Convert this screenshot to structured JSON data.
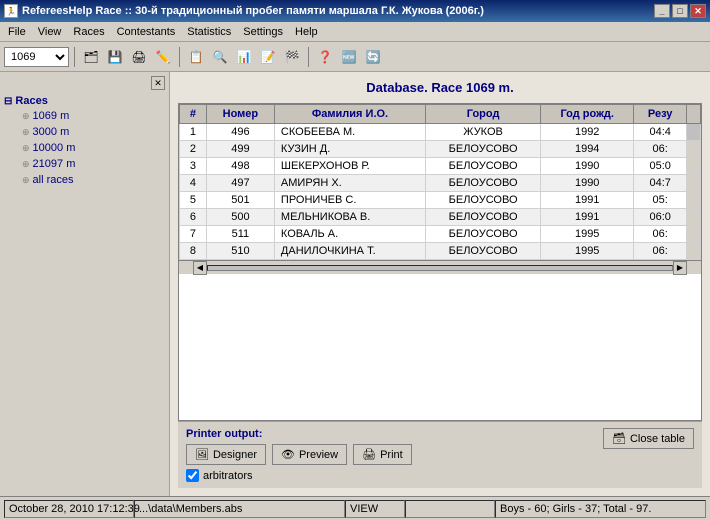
{
  "titlebar": {
    "text": "RefereesHelp Race :: 30-й традиционный пробег памяти маршала Г.К. Жукова (2006г.)",
    "buttons": [
      "_",
      "□",
      "✕"
    ]
  },
  "menubar": {
    "items": [
      "File",
      "View",
      "Races",
      "Contestants",
      "Statistics",
      "Settings",
      "Help"
    ]
  },
  "toolbar": {
    "select_value": "1069"
  },
  "sidebar": {
    "title": "Races",
    "items": [
      {
        "label": "1069 m"
      },
      {
        "label": "3000 m"
      },
      {
        "label": "10000 m"
      },
      {
        "label": "21097 m"
      },
      {
        "label": "all races"
      }
    ]
  },
  "content": {
    "title": "Database. Race 1069 m.",
    "table": {
      "columns": [
        "#",
        "Номер",
        "Фамилия И.О.",
        "Город",
        "Год рожд.",
        "Резу"
      ],
      "rows": [
        [
          "1",
          "496",
          "СКОБЕЕВА М.",
          "ЖУКОВ",
          "1992",
          "04:4"
        ],
        [
          "2",
          "499",
          "КУЗИН Д.",
          "БЕЛОУСОВО",
          "1994",
          "06:"
        ],
        [
          "3",
          "498",
          "ШЕКЕРХОНОВ Р.",
          "БЕЛОУСОВО",
          "1990",
          "05:0"
        ],
        [
          "4",
          "497",
          "АМИРЯН Х.",
          "БЕЛОУСОВО",
          "1990",
          "04:7"
        ],
        [
          "5",
          "501",
          "ПРОНИЧЕВ С.",
          "БЕЛОУСОВО",
          "1991",
          "05:"
        ],
        [
          "6",
          "500",
          "МЕЛЬНИКОВА В.",
          "БЕЛОУСОВО",
          "1991",
          "06:0"
        ],
        [
          "7",
          "511",
          "КОВАЛЬ А.",
          "БЕЛОУСОВО",
          "1995",
          "06:"
        ],
        [
          "8",
          "510",
          "ДАНИЛОЧКИНА Т.",
          "БЕЛОУСОВО",
          "1995",
          "06:"
        ]
      ]
    }
  },
  "bottom_panel": {
    "printer_label": "Printer output:",
    "designer_btn": "Designer",
    "preview_btn": "Preview",
    "print_btn": "Print",
    "close_btn": "Close table",
    "checkbox_label": "arbitrators",
    "checkbox_checked": true
  },
  "statusbar": {
    "datetime": "October 28, 2010 17:12:39",
    "file": "...\\data\\Members.abs",
    "view": "VIEW",
    "input": "",
    "stats": "Boys - 60;  Girls - 37;  Total - 97."
  }
}
